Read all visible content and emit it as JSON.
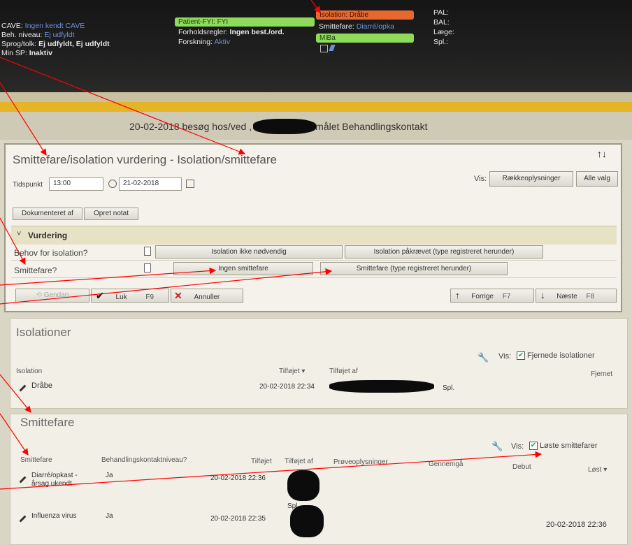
{
  "header": {
    "left": [
      {
        "label": "CAVE:",
        "value": "Ingen kendt CAVE"
      },
      {
        "label": "Beh. niveau:",
        "value": "Ej udfyldt"
      },
      {
        "label": "Sprog/tolk:",
        "value": "Ej udfyldt, Ej udfyldt"
      },
      {
        "label": "Min SP:",
        "value": "Inaktiv"
      }
    ],
    "patient_fyi": "Patient-FYI: FYI",
    "forholdsregler_label": "Forholdsregler:",
    "forholdsregler_value": "Ingen best./ord.",
    "forskning_label": "Forskning:",
    "forskning_value": "Aktiv",
    "isolation_badge": "Isolation: Dråbe",
    "smittefare_label": "Smittefare:",
    "smittefare_value": "Diarré/opka",
    "miba_badge": "MiBa",
    "right": [
      "PAL:",
      "BAL:",
      "Læge:",
      "Spl.:"
    ]
  },
  "visit_title": "20-02-2018 besøg hos/ved              , Læge med formålet Behandlingskontakt",
  "form": {
    "title": "Smittefare/isolation vurdering - Isolation/smittefare",
    "tidspunkt_label": "Tidspunkt",
    "time_value": "13:00",
    "date_value": "21-02-2018",
    "vis_label": "Vis:",
    "vis_buttons": [
      "Rækkeoplysninger",
      "Alle valg"
    ],
    "top_buttons": [
      "Dokumenteret af",
      "Opret notat"
    ],
    "section_title": "Vurdering",
    "q1_label": "Behov for isolation?",
    "q1_options": [
      "Isolation ikke nødvendig",
      "Isolation påkrævet (type registreret herunder)"
    ],
    "q2_label": "Smittefare?",
    "q2_options": [
      "Ingen smittefare",
      "Smittefare (type registreret herunder)"
    ],
    "footer": {
      "gendan": "Gendan",
      "luk": "Luk",
      "luk_key": "F9",
      "annuller": "Annuller",
      "forrige": "Forrige",
      "forrige_key": "F7",
      "naeste": "Næste",
      "naeste_key": "F8"
    }
  },
  "isolationer": {
    "title": "Isolationer",
    "vis_label": "Vis:",
    "checkbox_label": "Fjernede isolationer",
    "columns": [
      "Isolation",
      "Tilføjet",
      "Tilføjet af",
      "Fjernet"
    ],
    "rows": [
      {
        "isolation": "Dråbe",
        "tilfojet": "20-02-2018 22:34",
        "tilfojet_af": "Spl."
      }
    ]
  },
  "smittefare": {
    "title": "Smittefare",
    "vis_label": "Vis:",
    "checkbox_label": "Løste smittefarer",
    "columns": [
      "Smittefare",
      "Behandlingskontaktniveau?",
      "Tilføjet",
      "Tilføjet af",
      "Prøveoplysninger",
      "Gennemgå",
      "Debut",
      "Løst"
    ],
    "rows": [
      {
        "name": "Diarré/opkast - årsag ukendt",
        "niveau": "Ja",
        "tilfojet": "20-02-2018 22:36",
        "tilfojet_af": "Spl.",
        "lost": ""
      },
      {
        "name": "Influenza virus",
        "niveau": "Ja",
        "tilfojet": "20-02-2018 22:35",
        "tilfojet_af": "",
        "lost": "20-02-2018 22:36"
      }
    ]
  },
  "colors": {
    "isolation_badge": "#e8692f",
    "green_badge": "#8edb5a",
    "accent_band": "#e6b427",
    "arrow": "#ff0000"
  }
}
